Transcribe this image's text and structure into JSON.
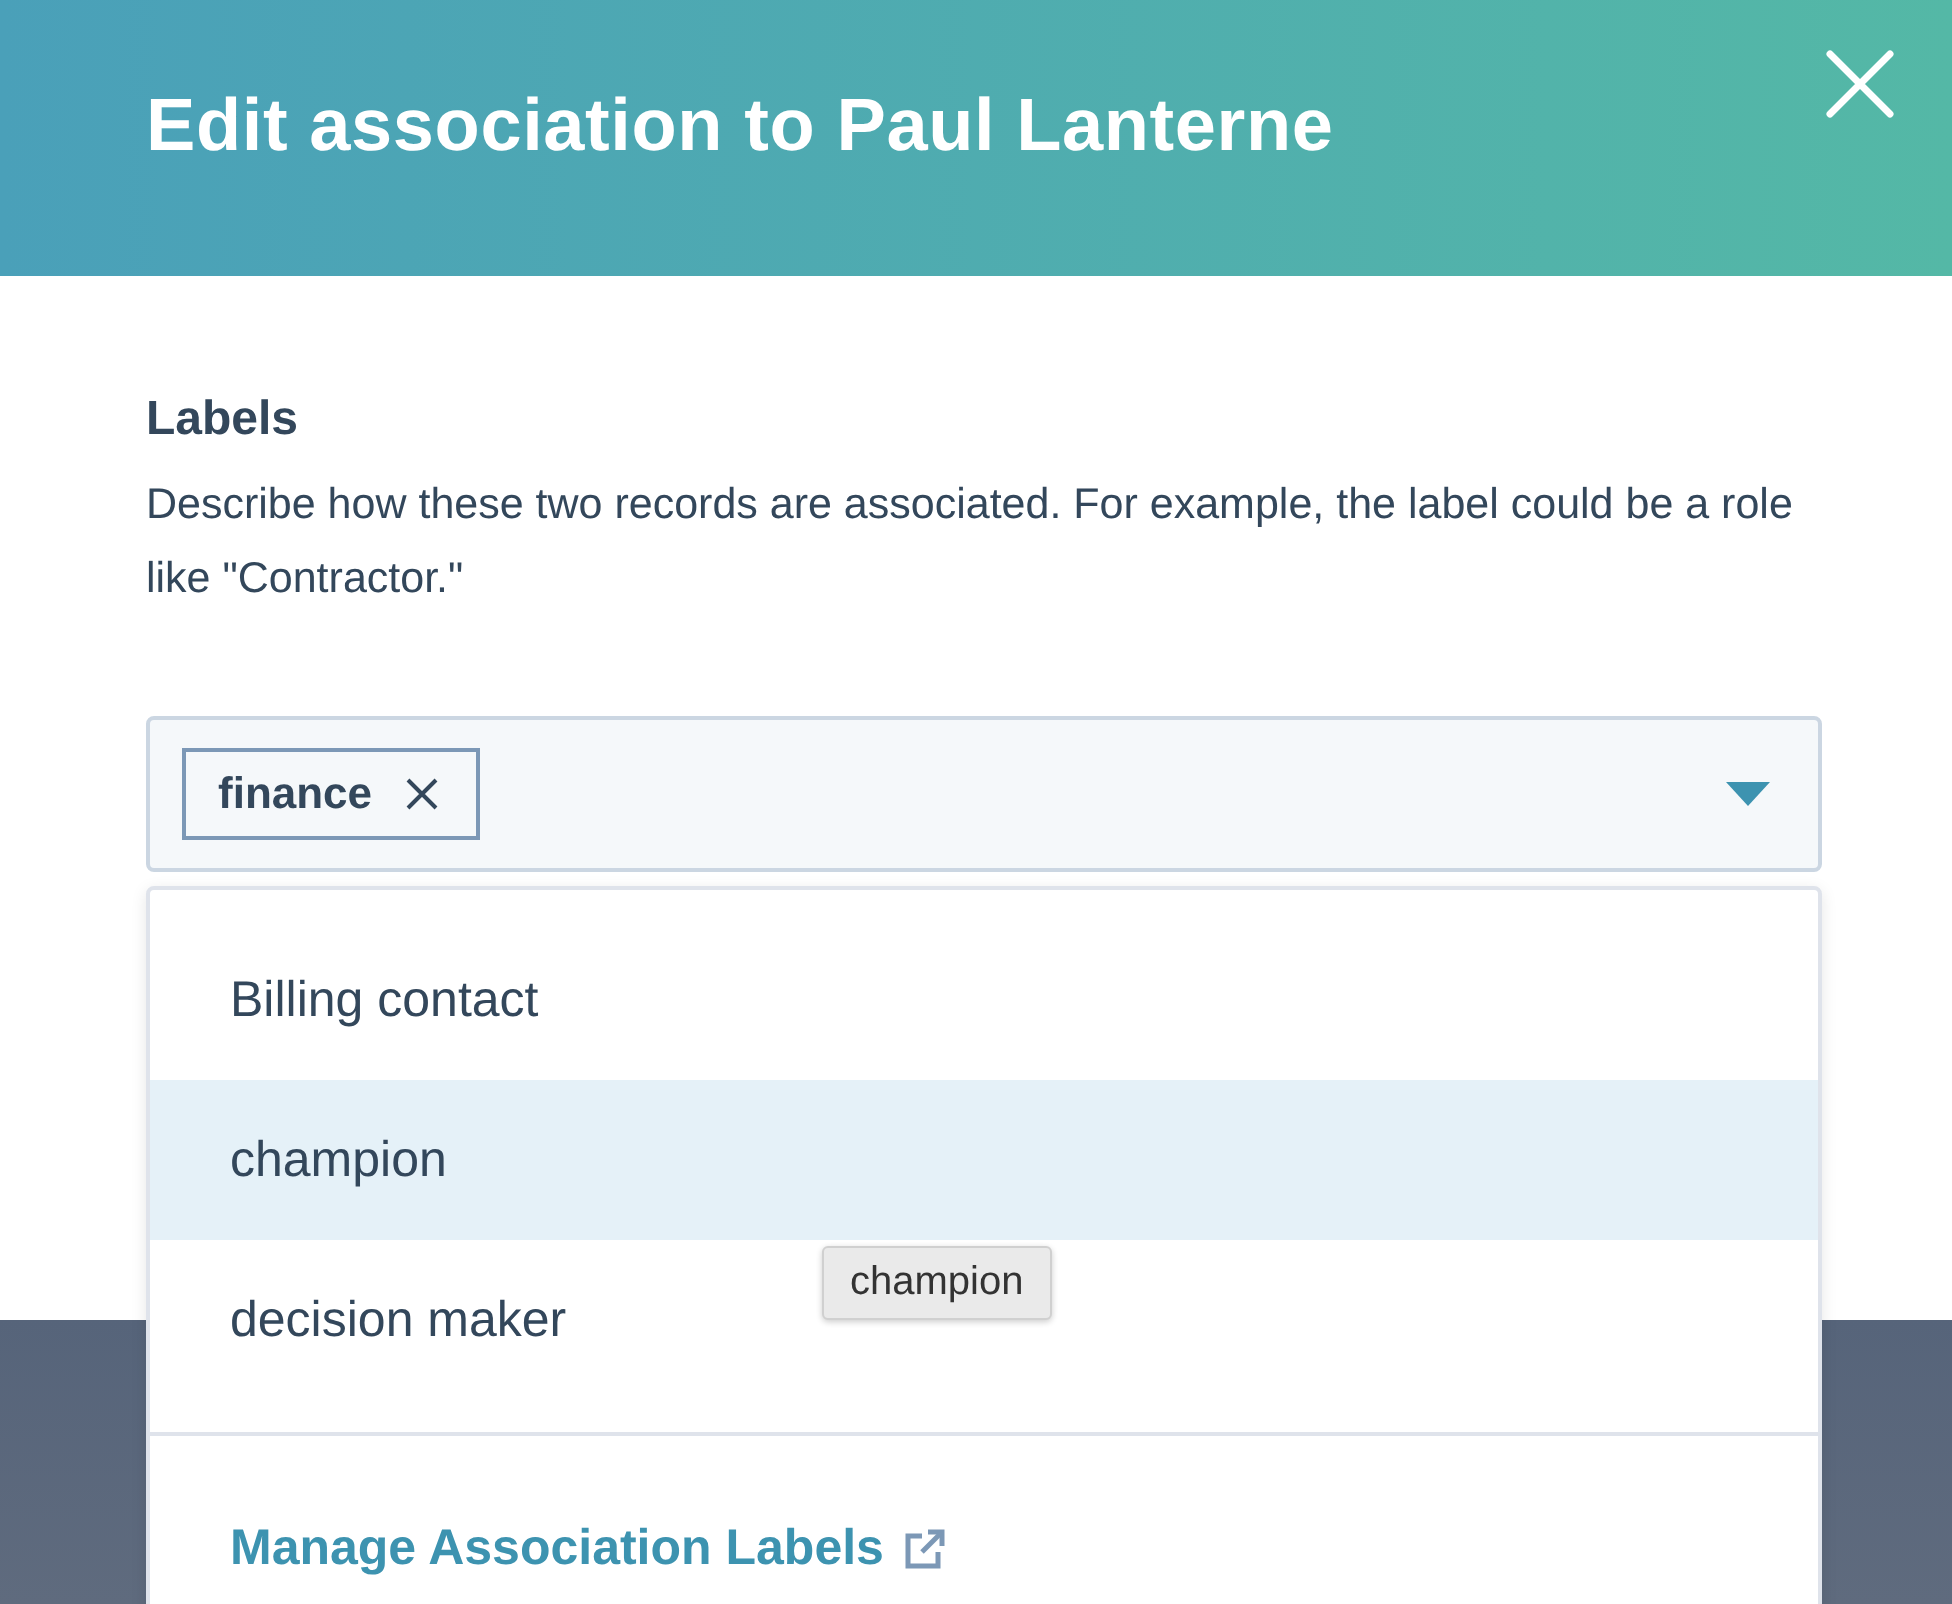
{
  "dialog": {
    "title": "Edit association to Paul Lanterne"
  },
  "labels_section": {
    "heading": "Labels",
    "description": "Describe how these two records are associated. For example, the label could be a role like \"Contractor.\""
  },
  "select": {
    "expanded": true,
    "tags": [
      {
        "label": "finance"
      }
    ]
  },
  "menu": {
    "options": [
      {
        "label": "Billing contact",
        "selected": false
      },
      {
        "label": "champion",
        "selected": true
      },
      {
        "label": "decision maker",
        "selected": false
      }
    ],
    "manage_link": "Manage Association Labels"
  },
  "tooltip": "champion"
}
